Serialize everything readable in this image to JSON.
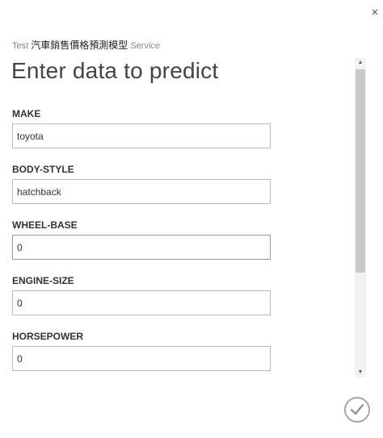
{
  "dialog": {
    "close_glyph": "×",
    "subtitle_prefix": "Test",
    "model_name": "汽車銷售價格預測模型",
    "subtitle_suffix": "Service",
    "title": "Enter data to predict"
  },
  "fields": [
    {
      "label": "MAKE",
      "value": "toyota"
    },
    {
      "label": "BODY-STYLE",
      "value": "hatchback"
    },
    {
      "label": "WHEEL-BASE",
      "value": "0"
    },
    {
      "label": "ENGINE-SIZE",
      "value": "0"
    },
    {
      "label": "HORSEPOWER",
      "value": "0"
    }
  ],
  "scrollbar": {
    "up_glyph": "▲",
    "down_glyph": "▼"
  },
  "colors": {
    "accent": "#a6a6a6",
    "text": "#333333"
  },
  "icons": {
    "close": "close-icon",
    "ok": "checkmark-icon"
  }
}
